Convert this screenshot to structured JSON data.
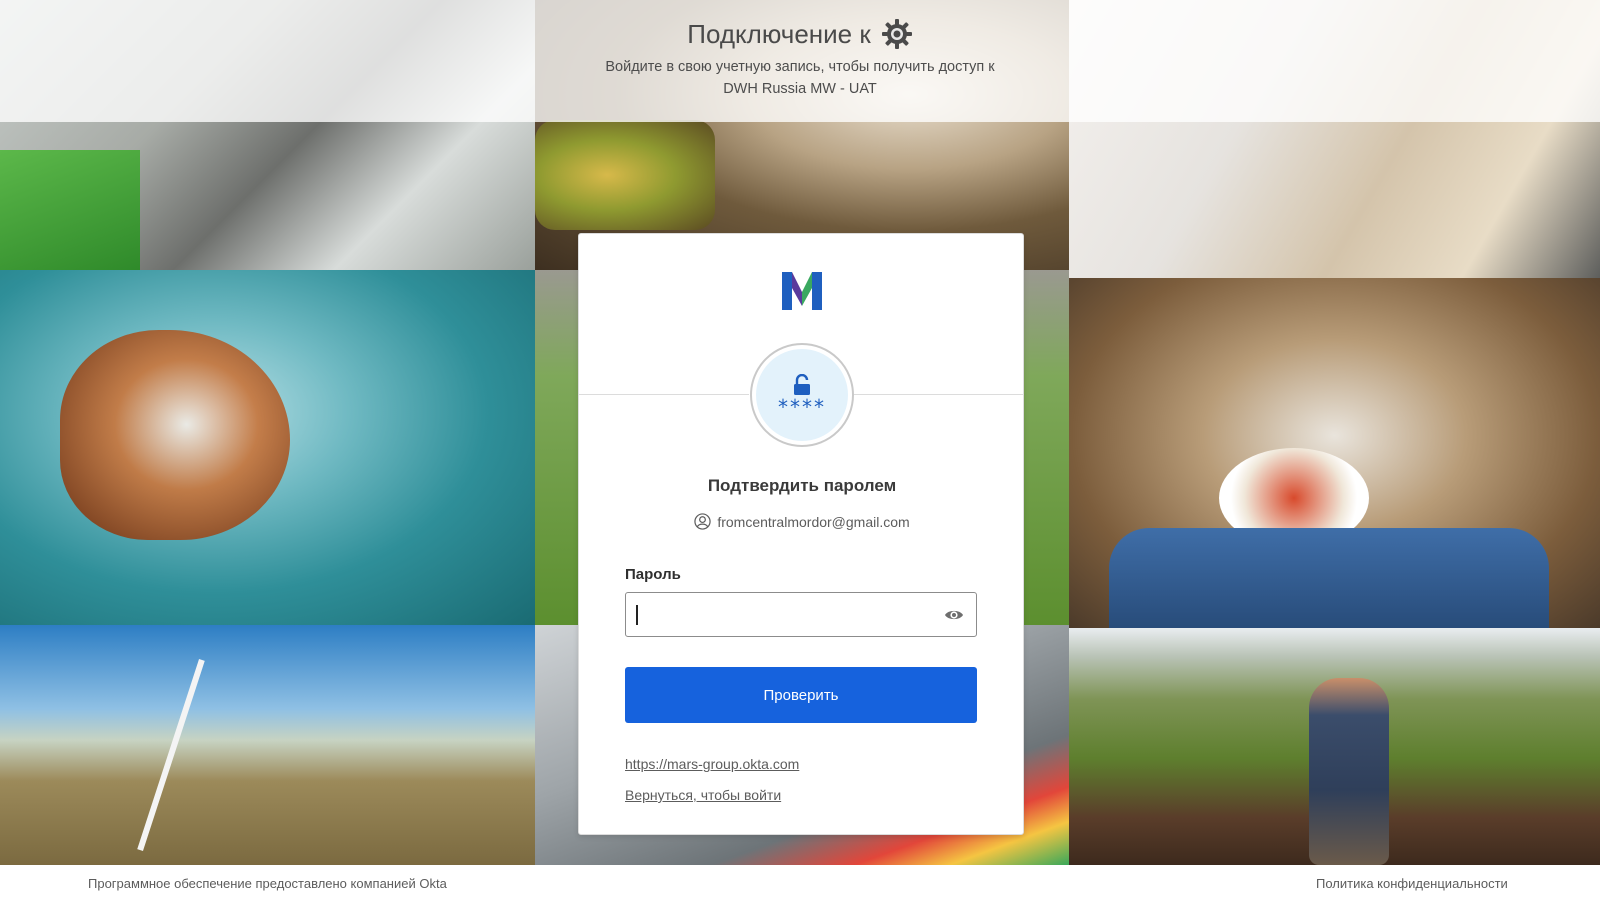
{
  "header": {
    "title": "Подключение к",
    "subtitle_line1": "Войдите в свою учетную запись, чтобы получить доступ к",
    "subtitle_line2": "DWH Russia MW - UAT"
  },
  "card": {
    "logo_letter": "M",
    "factor_stars": "****",
    "title": "Подтвердить паролем",
    "identifier": "fromcentralmordor@gmail.com",
    "password_label": "Пароль",
    "password_value": "",
    "verify_button": "Проверить",
    "okta_link": "https://mars-group.okta.com",
    "back_link": "Вернуться, чтобы войти"
  },
  "footer": {
    "powered_by": "Программное обеспечение предоставлено компанией Okta",
    "privacy": "Политика конфиденциальности"
  },
  "colors": {
    "accent": "#1662dd",
    "factor_bg": "#e3f2fb",
    "logo_blue": "#1f5fbf",
    "logo_purple": "#5a3a9c",
    "logo_green": "#3aa860"
  },
  "icons": {
    "header": "gear-icon",
    "factor": "lock-icon",
    "identifier": "user-icon",
    "password_toggle": "eye-icon"
  }
}
